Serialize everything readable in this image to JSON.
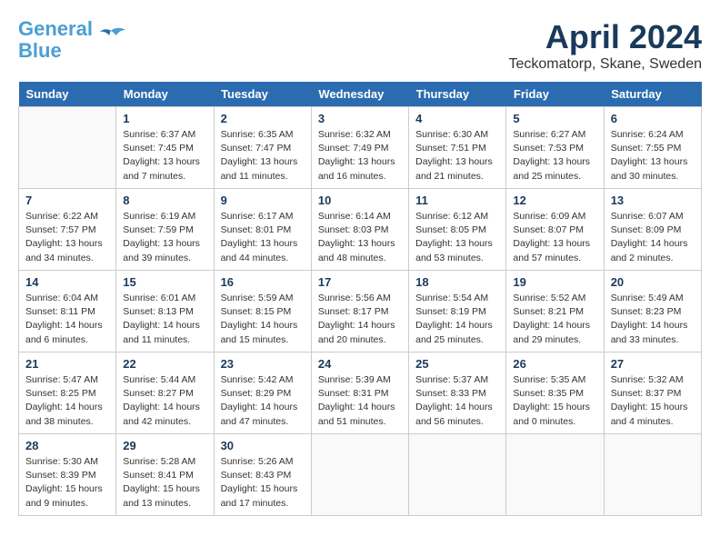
{
  "header": {
    "logo_line1": "General",
    "logo_line2": "Blue",
    "month": "April 2024",
    "location": "Teckomatorp, Skane, Sweden"
  },
  "columns": [
    "Sunday",
    "Monday",
    "Tuesday",
    "Wednesday",
    "Thursday",
    "Friday",
    "Saturday"
  ],
  "weeks": [
    [
      {
        "day": "",
        "info": ""
      },
      {
        "day": "1",
        "info": "Sunrise: 6:37 AM\nSunset: 7:45 PM\nDaylight: 13 hours\nand 7 minutes."
      },
      {
        "day": "2",
        "info": "Sunrise: 6:35 AM\nSunset: 7:47 PM\nDaylight: 13 hours\nand 11 minutes."
      },
      {
        "day": "3",
        "info": "Sunrise: 6:32 AM\nSunset: 7:49 PM\nDaylight: 13 hours\nand 16 minutes."
      },
      {
        "day": "4",
        "info": "Sunrise: 6:30 AM\nSunset: 7:51 PM\nDaylight: 13 hours\nand 21 minutes."
      },
      {
        "day": "5",
        "info": "Sunrise: 6:27 AM\nSunset: 7:53 PM\nDaylight: 13 hours\nand 25 minutes."
      },
      {
        "day": "6",
        "info": "Sunrise: 6:24 AM\nSunset: 7:55 PM\nDaylight: 13 hours\nand 30 minutes."
      }
    ],
    [
      {
        "day": "7",
        "info": "Sunrise: 6:22 AM\nSunset: 7:57 PM\nDaylight: 13 hours\nand 34 minutes."
      },
      {
        "day": "8",
        "info": "Sunrise: 6:19 AM\nSunset: 7:59 PM\nDaylight: 13 hours\nand 39 minutes."
      },
      {
        "day": "9",
        "info": "Sunrise: 6:17 AM\nSunset: 8:01 PM\nDaylight: 13 hours\nand 44 minutes."
      },
      {
        "day": "10",
        "info": "Sunrise: 6:14 AM\nSunset: 8:03 PM\nDaylight: 13 hours\nand 48 minutes."
      },
      {
        "day": "11",
        "info": "Sunrise: 6:12 AM\nSunset: 8:05 PM\nDaylight: 13 hours\nand 53 minutes."
      },
      {
        "day": "12",
        "info": "Sunrise: 6:09 AM\nSunset: 8:07 PM\nDaylight: 13 hours\nand 57 minutes."
      },
      {
        "day": "13",
        "info": "Sunrise: 6:07 AM\nSunset: 8:09 PM\nDaylight: 14 hours\nand 2 minutes."
      }
    ],
    [
      {
        "day": "14",
        "info": "Sunrise: 6:04 AM\nSunset: 8:11 PM\nDaylight: 14 hours\nand 6 minutes."
      },
      {
        "day": "15",
        "info": "Sunrise: 6:01 AM\nSunset: 8:13 PM\nDaylight: 14 hours\nand 11 minutes."
      },
      {
        "day": "16",
        "info": "Sunrise: 5:59 AM\nSunset: 8:15 PM\nDaylight: 14 hours\nand 15 minutes."
      },
      {
        "day": "17",
        "info": "Sunrise: 5:56 AM\nSunset: 8:17 PM\nDaylight: 14 hours\nand 20 minutes."
      },
      {
        "day": "18",
        "info": "Sunrise: 5:54 AM\nSunset: 8:19 PM\nDaylight: 14 hours\nand 25 minutes."
      },
      {
        "day": "19",
        "info": "Sunrise: 5:52 AM\nSunset: 8:21 PM\nDaylight: 14 hours\nand 29 minutes."
      },
      {
        "day": "20",
        "info": "Sunrise: 5:49 AM\nSunset: 8:23 PM\nDaylight: 14 hours\nand 33 minutes."
      }
    ],
    [
      {
        "day": "21",
        "info": "Sunrise: 5:47 AM\nSunset: 8:25 PM\nDaylight: 14 hours\nand 38 minutes."
      },
      {
        "day": "22",
        "info": "Sunrise: 5:44 AM\nSunset: 8:27 PM\nDaylight: 14 hours\nand 42 minutes."
      },
      {
        "day": "23",
        "info": "Sunrise: 5:42 AM\nSunset: 8:29 PM\nDaylight: 14 hours\nand 47 minutes."
      },
      {
        "day": "24",
        "info": "Sunrise: 5:39 AM\nSunset: 8:31 PM\nDaylight: 14 hours\nand 51 minutes."
      },
      {
        "day": "25",
        "info": "Sunrise: 5:37 AM\nSunset: 8:33 PM\nDaylight: 14 hours\nand 56 minutes."
      },
      {
        "day": "26",
        "info": "Sunrise: 5:35 AM\nSunset: 8:35 PM\nDaylight: 15 hours\nand 0 minutes."
      },
      {
        "day": "27",
        "info": "Sunrise: 5:32 AM\nSunset: 8:37 PM\nDaylight: 15 hours\nand 4 minutes."
      }
    ],
    [
      {
        "day": "28",
        "info": "Sunrise: 5:30 AM\nSunset: 8:39 PM\nDaylight: 15 hours\nand 9 minutes."
      },
      {
        "day": "29",
        "info": "Sunrise: 5:28 AM\nSunset: 8:41 PM\nDaylight: 15 hours\nand 13 minutes."
      },
      {
        "day": "30",
        "info": "Sunrise: 5:26 AM\nSunset: 8:43 PM\nDaylight: 15 hours\nand 17 minutes."
      },
      {
        "day": "",
        "info": ""
      },
      {
        "day": "",
        "info": ""
      },
      {
        "day": "",
        "info": ""
      },
      {
        "day": "",
        "info": ""
      }
    ]
  ]
}
